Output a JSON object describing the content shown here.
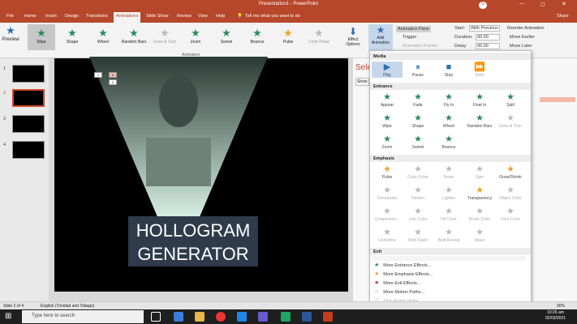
{
  "window": {
    "title": "Presentation1 - PowerPoint",
    "user_initials": "S"
  },
  "tabs": [
    "File",
    "Home",
    "Insert",
    "Design",
    "Transitions",
    "Animations",
    "Slide Show",
    "Review",
    "View",
    "Help",
    "Tell me what you want to do",
    "Share"
  ],
  "ribbon": {
    "preview": "Preview",
    "effects": [
      {
        "label": "Wipe",
        "style": "sel"
      },
      {
        "label": "Shape",
        "style": ""
      },
      {
        "label": "Wheel",
        "style": ""
      },
      {
        "label": "Random Bars",
        "style": ""
      },
      {
        "label": "Grow & Turn",
        "style": "gray"
      },
      {
        "label": "Zoom",
        "style": ""
      },
      {
        "label": "Swivel",
        "style": ""
      },
      {
        "label": "Bounce",
        "style": ""
      },
      {
        "label": "Pulse",
        "style": "orange"
      },
      {
        "label": "Color Pulse",
        "style": "gray"
      }
    ],
    "group_animation": "Animation",
    "effect_options": "Effect Options",
    "add_animation": "Add Animation",
    "animation_pane": "Animation Pane",
    "trigger": "Trigger",
    "animation_painter": "Animation Painter",
    "start_label": "Start:",
    "start_value": "With Previous",
    "duration_label": "Duration:",
    "duration_value": "00.50",
    "delay_label": "Delay:",
    "delay_value": "00.00",
    "reorder": "Reorder Animation",
    "move_earlier": "Move Earlier",
    "move_later": "Move Later"
  },
  "slides": [
    {
      "num": "1"
    },
    {
      "num": "2"
    },
    {
      "num": "3"
    },
    {
      "num": "4"
    }
  ],
  "slide": {
    "line1": "HOLLOGRAM",
    "line2": "GENERATOR",
    "tag1": "1",
    "tag2": "0",
    "tag3": "2"
  },
  "dropdown": {
    "media": "Media",
    "media_items": [
      "Play",
      "Pause",
      "Stop",
      "Seek"
    ],
    "entrance": "Entrance",
    "entrance_items": [
      "Appear",
      "Fade",
      "Fly In",
      "Float In",
      "Split",
      "Wipe",
      "Shape",
      "Wheel",
      "Random Bars",
      "Grow & Turn",
      "Zoom",
      "Swivel",
      "Bounce"
    ],
    "emphasis": "Emphasis",
    "emphasis_items": [
      "Pulse",
      "Color Pulse",
      "Teeter",
      "Spin",
      "Grow/Shrink",
      "Desaturate",
      "Darken",
      "Lighten",
      "Transparency",
      "Object Color",
      "Complemen...",
      "Line Color",
      "Fill Color",
      "Brush Color",
      "Font Color",
      "Underline",
      "Bold Flash",
      "Bold Reveal",
      "Wave"
    ],
    "exit": "Exit",
    "more": [
      "More Entrance Effects...",
      "More Emphasis Effects...",
      "More Exit Effects...",
      "More Motion Paths...",
      "OLE Action Verbs..."
    ]
  },
  "rightpane": {
    "title": "Sele",
    "btn": "Show"
  },
  "status": {
    "slide": "Slide 2 of 4",
    "lang": "English (Trinidad and Tobago)",
    "zoom": "90%"
  },
  "taskbar": {
    "search": "Type here to search",
    "time": "10:26 am",
    "date": "02/03/2021"
  }
}
